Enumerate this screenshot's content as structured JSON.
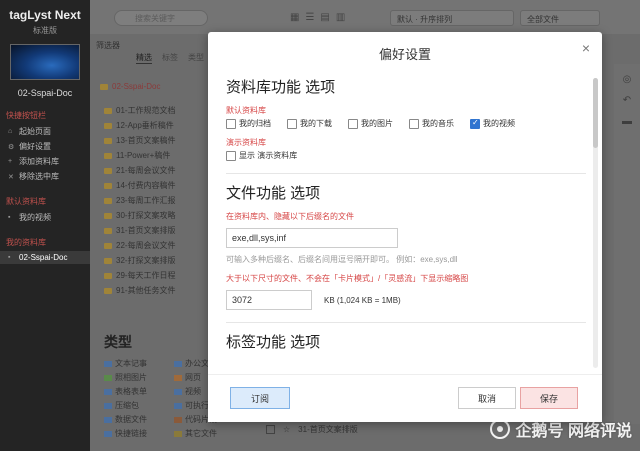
{
  "sidebar": {
    "app_title": "tagLyst Next",
    "edition": "标准版",
    "library_name": "02-Sspai-Doc",
    "quick_actions_title": "快捷按钮栏",
    "quick_actions": [
      "起始页面",
      "偏好设置",
      "添加资料库",
      "移除选中库"
    ],
    "default_lib_title": "默认资料库",
    "default_lib_item": "我的视频",
    "my_libs_title": "我的资料库",
    "my_libs_item": "02-Sspai-Doc"
  },
  "topbar": {
    "search_placeholder": "搜索关键字",
    "sort_label": "默认 · 升序排列",
    "files_label": "全部文件"
  },
  "filter": {
    "title": "筛选器",
    "tabs": [
      "精选",
      "标签",
      "类型"
    ]
  },
  "folders": {
    "root": "02-Sspai-Doc",
    "items": [
      "01-工作规范文档",
      "12-App垂析稿件",
      "13-首页文案稿件",
      "11-Power+稿件",
      "21-每周会议文件",
      "14-付费内容稿件",
      "23-每周工作汇报",
      "30-打探文案攻略",
      "31-首页文案排版",
      "22-每周会议文件",
      "32-打探文案排版",
      "29-每天工作日程",
      "91-其他任务文件"
    ]
  },
  "types": {
    "title": "类型",
    "items": [
      "文本记事",
      "办公文",
      "照相图片",
      "网页",
      "表格表单",
      "视频",
      "压缩包",
      "可执行",
      "数据文件",
      "代码片段",
      "快捷链接",
      "其它文件"
    ]
  },
  "bottom_row": {
    "label": "31-首页文案排版"
  },
  "watermark": {
    "text": "企鹅号 网络评说"
  },
  "dialog": {
    "title": "偏好设置",
    "close_glyph": "×",
    "library_section": {
      "heading": "资料库功能 选项",
      "default_lib_label": "默认资料库",
      "default_options": [
        {
          "label": "我的归档",
          "checked": false
        },
        {
          "label": "我的下载",
          "checked": false
        },
        {
          "label": "我的图片",
          "checked": false
        },
        {
          "label": "我的音乐",
          "checked": false
        },
        {
          "label": "我的视频",
          "checked": true
        }
      ],
      "demo_lib_label": "演示资料库",
      "demo_option": {
        "label": "显示 演示资料库",
        "checked": false
      }
    },
    "file_section": {
      "heading": "文件功能 选项",
      "hide_ext_label": "在资料库内、隐藏以下后缀名的文件",
      "hide_ext_value": "exe,dll,sys,inf",
      "hide_ext_hint": "可输入多种后缀名、后缀名间用逗号隔开即可。 例如：exe,sys,dll",
      "thumb_label": "大于以下尺寸的文件、不会在「卡片模式」/「灵感流」下显示缩略图",
      "thumb_value": "3072",
      "thumb_unit": "KB (1,024 KB = 1MB)"
    },
    "tag_section": {
      "heading": "标签功能 选项"
    },
    "buttons": {
      "subscribe": "订阅",
      "cancel": "取消",
      "save": "保存"
    }
  },
  "colors": {
    "accent_red": "#d64545",
    "checkbox_blue": "#2f74d0",
    "sidebar_bg": "#242424"
  }
}
